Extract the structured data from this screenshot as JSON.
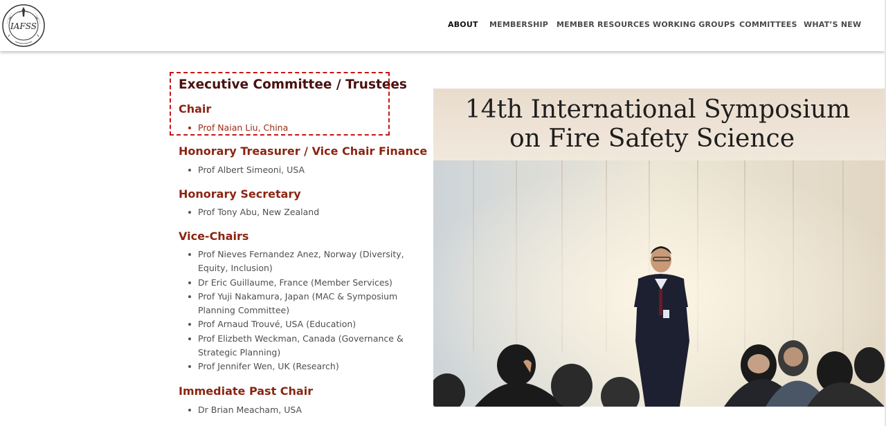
{
  "header": {
    "logo_text": "IAFSS",
    "nav": [
      {
        "label": "ABOUT",
        "active": true
      },
      {
        "label": "MEMBERSHIP",
        "active": false
      },
      {
        "label": "MEMBER RESOURCES",
        "active": false
      },
      {
        "label": "WORKING GROUPS",
        "active": false
      },
      {
        "label": "COMMITTEES",
        "active": false
      },
      {
        "label": "WHAT’S NEW",
        "active": false
      }
    ]
  },
  "main": {
    "title": "Executive Committee / Trustees",
    "sections": [
      {
        "heading": "Chair",
        "members": [
          "Prof Naian Liu, China"
        ]
      },
      {
        "heading": "Honorary Treasurer / Vice Chair Finance",
        "members": [
          "Prof Albert Simeoni, USA"
        ]
      },
      {
        "heading": "Honorary Secretary",
        "members": [
          "Prof Tony Abu, New Zealand"
        ]
      },
      {
        "heading": "Vice-Chairs",
        "members": [
          "Prof Nieves Fernandez Anez, Norway (Diversity, Equity, Inclusion)",
          "Dr Eric Guillaume, France (Member Services)",
          "Prof Yuji Nakamura, Japan (MAC & Symposium Planning Committee)",
          "Prof Arnaud Trouvé, USA (Education)",
          "Prof Elizbeth Weckman, Canada (Governance & Strategic Planning)",
          "Prof Jennifer Wen, UK (Research)"
        ]
      },
      {
        "heading": "Immediate Past Chair",
        "members": [
          "Dr Brian Meacham, USA"
        ]
      }
    ]
  },
  "photo": {
    "banner_line1": "14th International Symposium",
    "banner_line2": "on Fire Safety Science"
  },
  "colors": {
    "title": "#4a1010",
    "heading": "#8b2512",
    "link": "#9b2a14",
    "highlight": "#c81414"
  }
}
